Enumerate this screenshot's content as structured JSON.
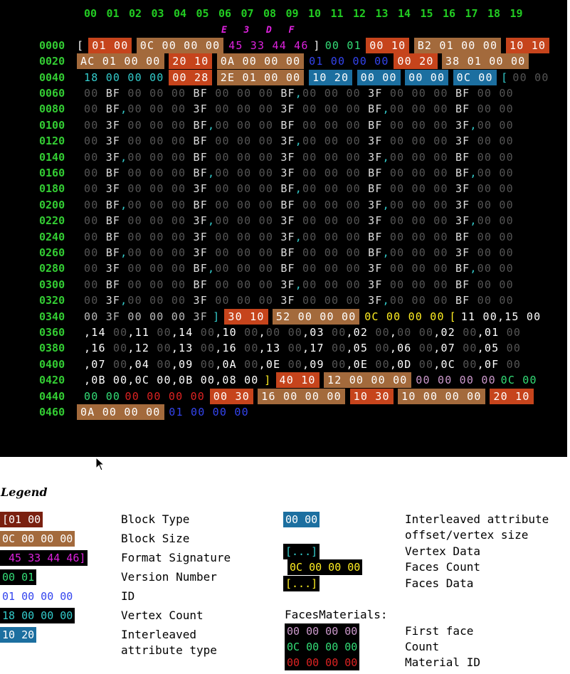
{
  "colors": {
    "background": "#000000",
    "zero_gray": "#555555",
    "header_green": "#22cc22",
    "offset_green": "#33cc33",
    "block_type_bg": "#c6441c",
    "block_size_bg": "#a36a3c",
    "signature_magenta": "#dd22dd",
    "version_green": "#33dd77",
    "id_blue": "#3344ee",
    "vertex_count_cyan": "#33cccc",
    "interleaved_bg": "#1c6fa0",
    "faces_yellow": "#ffee22",
    "first_face_lilac": "#cc99cc",
    "material_red": "#dd2222"
  },
  "column_headers": [
    "00",
    "01",
    "02",
    "03",
    "04",
    "05",
    "06",
    "07",
    "08",
    "09",
    "10",
    "11",
    "12",
    "13",
    "14",
    "15",
    "16",
    "17",
    "18",
    "19"
  ],
  "signature_chars": [
    "E",
    "3",
    "D",
    "F"
  ],
  "rows": [
    {
      "offset": "0000",
      "cells": [
        [
          "[",
          "w"
        ],
        [
          "01 00",
          "tb"
        ],
        [
          "0C 00 00 00",
          "sb"
        ],
        [
          "45 33 44 46",
          "m"
        ],
        [
          "]",
          "w"
        ],
        [
          "00 01",
          "v"
        ],
        [
          "00 10",
          "tb"
        ],
        [
          "B2 01 00 00",
          "sb"
        ],
        [
          "10 10",
          "tb"
        ]
      ]
    },
    {
      "offset": "0020",
      "cells": [
        [
          "AC 01 00 00",
          "sb"
        ],
        [
          "20 10",
          "tb"
        ],
        [
          "0A 00 00 00",
          "sb"
        ],
        [
          "01 00 00 00",
          "id"
        ],
        [
          "00 20",
          "tb"
        ],
        [
          "38 01 00 00",
          "sb"
        ]
      ]
    },
    {
      "offset": "0040",
      "cells": [
        [
          "18 00 00 00",
          "vc"
        ],
        [
          "00 28",
          "tb"
        ],
        [
          "2E 01 00 00",
          "sb"
        ],
        [
          "10 20",
          "il"
        ],
        [
          "00 00",
          "il"
        ],
        [
          "00 00",
          "il"
        ],
        [
          "0C 00",
          "il"
        ],
        [
          "[",
          "c"
        ],
        [
          "00 00",
          "g"
        ]
      ]
    },
    {
      "offset": "0060",
      "text": "00 BF 00 00 00 BF 00 00 00 BF,00 00 00 3F 00 00 00 BF 00 00"
    },
    {
      "offset": "0080",
      "text": "00 BF,00 00 00 3F 00 00 00 3F 00 00 00 BF,00 00 00 BF 00 00"
    },
    {
      "offset": "0100",
      "text": "00 3F 00 00 00 BF,00 00 00 BF 00 00 00 BF 00 00 00 3F,00 00"
    },
    {
      "offset": "0120",
      "text": "00 3F 00 00 00 BF 00 00 00 3F,00 00 00 3F 00 00 00 3F 00 00"
    },
    {
      "offset": "0140",
      "text": "00 3F,00 00 00 BF 00 00 00 3F 00 00 00 3F,00 00 00 BF 00 00"
    },
    {
      "offset": "0160",
      "text": "00 BF 00 00 00 BF,00 00 00 3F 00 00 00 BF 00 00 00 BF,00 00"
    },
    {
      "offset": "0180",
      "text": "00 3F 00 00 00 3F 00 00 00 BF,00 00 00 BF 00 00 00 3F 00 00"
    },
    {
      "offset": "0200",
      "text": "00 BF,00 00 00 BF 00 00 00 BF 00 00 00 3F,00 00 00 3F 00 00"
    },
    {
      "offset": "0220",
      "text": "00 BF 00 00 00 3F,00 00 00 3F 00 00 00 3F 00 00 00 3F,00 00"
    },
    {
      "offset": "0240",
      "text": "00 BF 00 00 00 3F 00 00 00 3F,00 00 00 BF 00 00 00 BF 00 00"
    },
    {
      "offset": "0260",
      "text": "00 BF,00 00 00 3F 00 00 00 BF 00 00 00 BF,00 00 00 3F 00 00"
    },
    {
      "offset": "0280",
      "text": "00 3F 00 00 00 BF,00 00 00 BF 00 00 00 3F 00 00 00 BF,00 00"
    },
    {
      "offset": "0300",
      "text": "00 BF 00 00 00 BF 00 00 00 3F,00 00 00 3F 00 00 00 BF 00 00"
    },
    {
      "offset": "0320",
      "text": "00 3F,00 00 00 3F 00 00 00 3F 00 00 00 3F,00 00 00 BF 00 00"
    },
    {
      "offset": "0340",
      "cells": [
        [
          "00 3F 00 00 00 3F",
          "vx"
        ],
        [
          "]",
          "c"
        ],
        [
          "30 10",
          "tb"
        ],
        [
          "52 00 00 00",
          "sb"
        ],
        [
          "0C 00 00 00",
          "fy"
        ],
        [
          "[",
          "y"
        ],
        [
          "11 00,15 00",
          "fd"
        ]
      ]
    },
    {
      "offset": "0360",
      "text": ",14 00,11 00,14 00,10 00,00 00,03 00,02 00,00 00,02 00,01 00",
      "faces": true
    },
    {
      "offset": "0380",
      "text": ",16 00,12 00,13 00,16 00,13 00,17 00,05 00,06 00,07 00,05 00",
      "faces": true
    },
    {
      "offset": "0400",
      "text": ",07 00,04 00,09 00,0A 00,0E 00,09 00,0E 00,0D 00,0C 00,0F 00",
      "faces": true
    },
    {
      "offset": "0420",
      "cells": [
        [
          ",0B 00,0C 00,0B 00,08 00",
          "fd"
        ],
        [
          "]",
          "y"
        ],
        [
          "40 10",
          "tb"
        ],
        [
          "12 00 00 00",
          "sb"
        ],
        [
          "00 00 00 00",
          "ff"
        ],
        [
          "0C 00",
          "fc"
        ]
      ]
    },
    {
      "offset": "0440",
      "cells": [
        [
          "00 00",
          "fc"
        ],
        [
          "00 00 00 00",
          "mr"
        ],
        [
          "00 30",
          "tb"
        ],
        [
          "16 00 00 00",
          "sb"
        ],
        [
          "10 30",
          "tb"
        ],
        [
          "10 00 00 00",
          "sb"
        ],
        [
          "20 10",
          "tb"
        ]
      ]
    },
    {
      "offset": "0460",
      "cells": [
        [
          "0A 00 00 00",
          "sb"
        ],
        [
          "01 00 00 00",
          "id"
        ]
      ]
    }
  ],
  "legend": {
    "title": "Legend",
    "items_left": [
      {
        "swatch": "[01 00",
        "label": "Block Type"
      },
      {
        "swatch": "0C 00 00 00",
        "label": "Block Size"
      },
      {
        "swatch": " 45 33 44 46]",
        "label": "Format Signature"
      },
      {
        "swatch": "00 01",
        "label": "Version Number"
      },
      {
        "swatch": "01 00 00 00",
        "label": "ID"
      },
      {
        "swatch": "18 00 00 00",
        "label": "Vertex Count"
      },
      {
        "swatch": "10 20",
        "label": "Interleaved\nattribute type"
      }
    ],
    "items_right": [
      {
        "swatch": "00 00",
        "label": "Interleaved attribute\noffset/vertex size"
      },
      {
        "swatch": "[...]",
        "label": "Vertex Data"
      },
      {
        "swatch": "0C 00 00 00",
        "label": "Faces Count"
      },
      {
        "swatch": "[...]",
        "label": "Faces Data"
      }
    ],
    "faces_materials_label": "FacesMaterials:",
    "faces_materials": [
      {
        "swatch": "00 00 00 00",
        "label": "First face"
      },
      {
        "swatch": "0C 00 00 00",
        "label": "Count"
      },
      {
        "swatch": "00 00 00 00",
        "label": "Material ID"
      }
    ]
  }
}
